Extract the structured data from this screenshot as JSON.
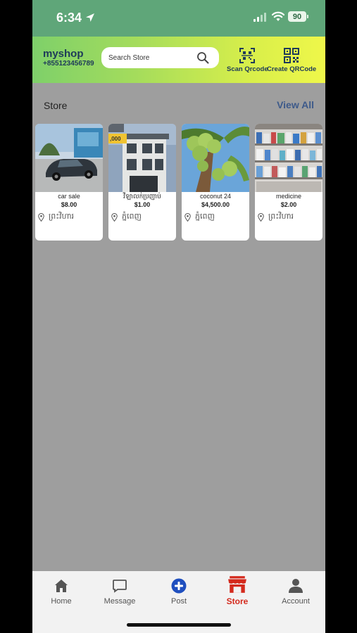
{
  "status_bar": {
    "time": "6:34",
    "battery": "90"
  },
  "header": {
    "shop_name": "myshop",
    "shop_phone": "+855123456789",
    "search_placeholder": "Search Store",
    "scan_label": "Scan Qrcode",
    "create_label": "Create QRCode"
  },
  "section": {
    "title": "Store",
    "view_all": "View All"
  },
  "stores": [
    {
      "title": "car sale",
      "price": "$8.00",
      "location": "ព្រះវិហារ",
      "image": "car-photo"
    },
    {
      "title": "វីឡាលក់ប្រញាប់",
      "price": "$1.00",
      "location": "ភ្នំពេញ",
      "image": "house-photo"
    },
    {
      "title": "coconut 24",
      "price": "$4,500.00",
      "location": "ភ្នំពេញ",
      "image": "coconut-photo"
    },
    {
      "title": "medicine",
      "price": "$2.00",
      "location": "ព្រះវិហារ",
      "image": "pharmacy-shelf-photo"
    }
  ],
  "nav": {
    "home": "Home",
    "message": "Message",
    "post": "Post",
    "store": "Store",
    "account": "Account"
  },
  "colors": {
    "status_bar": "#5fa679",
    "header_gradient_start": "#7ed06a",
    "header_gradient_end": "#eff74a",
    "content_bg": "#9e9e9e",
    "active_nav": "#d42a1d",
    "post_icon": "#1f4fbf",
    "view_all": "#3d5a8a"
  }
}
